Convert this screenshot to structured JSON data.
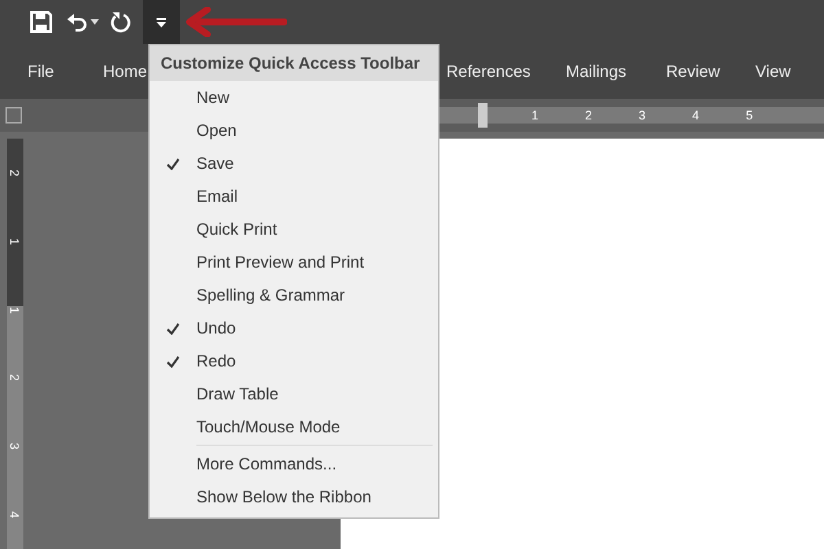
{
  "ribbon_tabs": [
    {
      "label": "File"
    },
    {
      "label": "Home"
    },
    {
      "label": "References"
    },
    {
      "label": "Mailings"
    },
    {
      "label": "Review"
    },
    {
      "label": "View"
    }
  ],
  "horizontal_ruler": {
    "numbers": [
      "1",
      "2",
      "3",
      "4",
      "5"
    ]
  },
  "vertical_ruler": {
    "numbers": [
      "2",
      "1",
      "1",
      "2",
      "3",
      "4"
    ]
  },
  "menu": {
    "title": "Customize Quick Access Toolbar",
    "items": [
      {
        "label": "New",
        "checked": false,
        "kind": "option"
      },
      {
        "label": "Open",
        "checked": false,
        "kind": "option"
      },
      {
        "label": "Save",
        "checked": true,
        "kind": "option"
      },
      {
        "label": "Email",
        "checked": false,
        "kind": "option"
      },
      {
        "label": "Quick Print",
        "checked": false,
        "kind": "option"
      },
      {
        "label": "Print Preview and Print",
        "checked": false,
        "kind": "option"
      },
      {
        "label": "Spelling & Grammar",
        "checked": false,
        "kind": "option"
      },
      {
        "label": "Undo",
        "checked": true,
        "kind": "option"
      },
      {
        "label": "Redo",
        "checked": true,
        "kind": "option"
      },
      {
        "label": "Draw Table",
        "checked": false,
        "kind": "option"
      },
      {
        "label": "Touch/Mouse Mode",
        "checked": false,
        "kind": "option"
      },
      {
        "label": "More Commands...",
        "kind": "command"
      },
      {
        "label": "Show Below the Ribbon",
        "kind": "command"
      }
    ]
  }
}
